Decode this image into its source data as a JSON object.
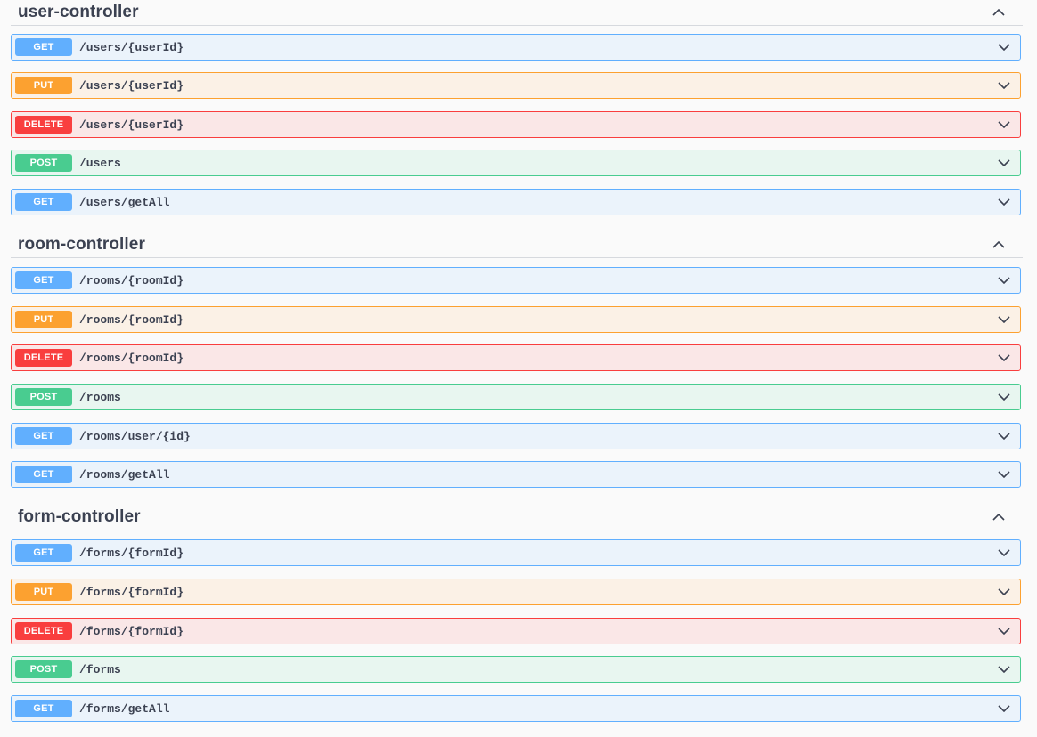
{
  "colors": {
    "get": "#61affe",
    "put": "#fca130",
    "delete": "#f93e3e",
    "post": "#49cc90"
  },
  "sections": [
    {
      "title": "user-controller",
      "toggle_icon": "chevron-up-icon",
      "operations": [
        {
          "method": "GET",
          "path": "/users/{userId}"
        },
        {
          "method": "PUT",
          "path": "/users/{userId}"
        },
        {
          "method": "DELETE",
          "path": "/users/{userId}"
        },
        {
          "method": "POST",
          "path": "/users"
        },
        {
          "method": "GET",
          "path": "/users/getAll"
        }
      ]
    },
    {
      "title": "room-controller",
      "toggle_icon": "chevron-up-icon",
      "operations": [
        {
          "method": "GET",
          "path": "/rooms/{roomId}"
        },
        {
          "method": "PUT",
          "path": "/rooms/{roomId}"
        },
        {
          "method": "DELETE",
          "path": "/rooms/{roomId}"
        },
        {
          "method": "POST",
          "path": "/rooms"
        },
        {
          "method": "GET",
          "path": "/rooms/user/{id}"
        },
        {
          "method": "GET",
          "path": "/rooms/getAll"
        }
      ]
    },
    {
      "title": "form-controller",
      "toggle_icon": "chevron-up-icon",
      "operations": [
        {
          "method": "GET",
          "path": "/forms/{formId}"
        },
        {
          "method": "PUT",
          "path": "/forms/{formId}"
        },
        {
          "method": "DELETE",
          "path": "/forms/{formId}"
        },
        {
          "method": "POST",
          "path": "/forms"
        },
        {
          "method": "GET",
          "path": "/forms/getAll"
        }
      ]
    }
  ]
}
